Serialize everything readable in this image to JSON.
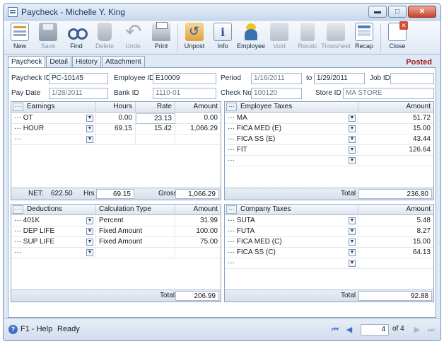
{
  "window": {
    "title": "Paycheck - Michelle Y. King"
  },
  "toolbar": {
    "buttons": [
      {
        "label": "New",
        "icon": "new-icon"
      },
      {
        "label": "Save",
        "icon": "save-icon"
      },
      {
        "label": "Find",
        "icon": "find-icon"
      },
      {
        "label": "Delete",
        "icon": "delete-icon"
      },
      {
        "label": "Undo",
        "icon": "undo-icon"
      },
      {
        "label": "Print",
        "icon": "print-icon"
      },
      {
        "label": "Unpost",
        "icon": "unpost-icon"
      },
      {
        "label": "Info",
        "icon": "info-icon"
      },
      {
        "label": "Employee",
        "icon": "employee-icon"
      },
      {
        "label": "Void",
        "icon": "void-icon"
      },
      {
        "label": "Recalc",
        "icon": "recalc-icon"
      },
      {
        "label": "Timesheet",
        "icon": "timesheet-icon"
      },
      {
        "label": "Recap",
        "icon": "recap-icon"
      },
      {
        "label": "Close",
        "icon": "close-icon"
      }
    ]
  },
  "tabs": [
    "Paycheck",
    "Detail",
    "History",
    "Attachment"
  ],
  "status_label": "Posted",
  "form": {
    "paycheck_id_label": "Paycheck ID",
    "paycheck_id": "PC-10145",
    "employee_id_label": "Employee ID",
    "employee_id": "E10009",
    "period_label": "Period",
    "period_from": "1/16/2011",
    "period_to_label": "to",
    "period_to": "1/29/2011",
    "job_id_label": "Job ID",
    "job_id": "",
    "pay_date_label": "Pay Date",
    "pay_date": "1/28/2011",
    "bank_id_label": "Bank ID",
    "bank_id": "1110-01",
    "check_no_label": "Check No",
    "check_no": "100120",
    "store_id_label": "Store ID",
    "store_id": "MA STORE"
  },
  "earnings": {
    "headers": {
      "name": "Earnings",
      "hours": "Hours",
      "rate": "Rate",
      "amount": "Amount"
    },
    "rows": [
      {
        "name": "OT",
        "hours": "0.00",
        "rate": "23.13",
        "amount": "0.00"
      },
      {
        "name": "HOUR",
        "hours": "69.15",
        "rate": "15.42",
        "amount": "1,066.29"
      },
      {
        "name": "",
        "hours": "",
        "rate": "",
        "amount": ""
      }
    ],
    "footer": {
      "net_label": "NET:",
      "net": "622.50",
      "hrs_label": "Hrs",
      "hrs": "69.15",
      "gross_label": "Gross",
      "gross": "1,066.29"
    }
  },
  "employee_taxes": {
    "headers": {
      "name": "Employee Taxes",
      "amount": "Amount"
    },
    "rows": [
      {
        "name": "MA",
        "amount": "51.72"
      },
      {
        "name": "FICA MED (E)",
        "amount": "15.00"
      },
      {
        "name": "FICA SS (E)",
        "amount": "43.44"
      },
      {
        "name": "FIT",
        "amount": "126.64"
      },
      {
        "name": "",
        "amount": ""
      }
    ],
    "footer": {
      "total_label": "Total",
      "total": "236.80"
    }
  },
  "deductions": {
    "headers": {
      "name": "Deductions",
      "calc": "Calculation Type",
      "amount": "Amount"
    },
    "rows": [
      {
        "name": "401K",
        "calc": "Percent",
        "amount": "31.99"
      },
      {
        "name": "DEP LIFE",
        "calc": "Fixed Amount",
        "amount": "100.00"
      },
      {
        "name": "SUP LIFE",
        "calc": "Fixed Amount",
        "amount": "75.00"
      },
      {
        "name": "",
        "calc": "",
        "amount": ""
      }
    ],
    "footer": {
      "total_label": "Total",
      "total": "206.99"
    }
  },
  "company_taxes": {
    "headers": {
      "name": "Company Taxes",
      "amount": "Amount"
    },
    "rows": [
      {
        "name": "SUTA",
        "amount": "5.48"
      },
      {
        "name": "FUTA",
        "amount": "8.27"
      },
      {
        "name": "FICA MED (C)",
        "amount": "15.00"
      },
      {
        "name": "FICA SS (C)",
        "amount": "64.13"
      },
      {
        "name": "",
        "amount": ""
      }
    ],
    "footer": {
      "total_label": "Total",
      "total": "92.88"
    }
  },
  "statusbar": {
    "help": "F1 - Help",
    "status": "Ready",
    "page": "4",
    "of_label": "of 4"
  },
  "row_prefix": "···"
}
